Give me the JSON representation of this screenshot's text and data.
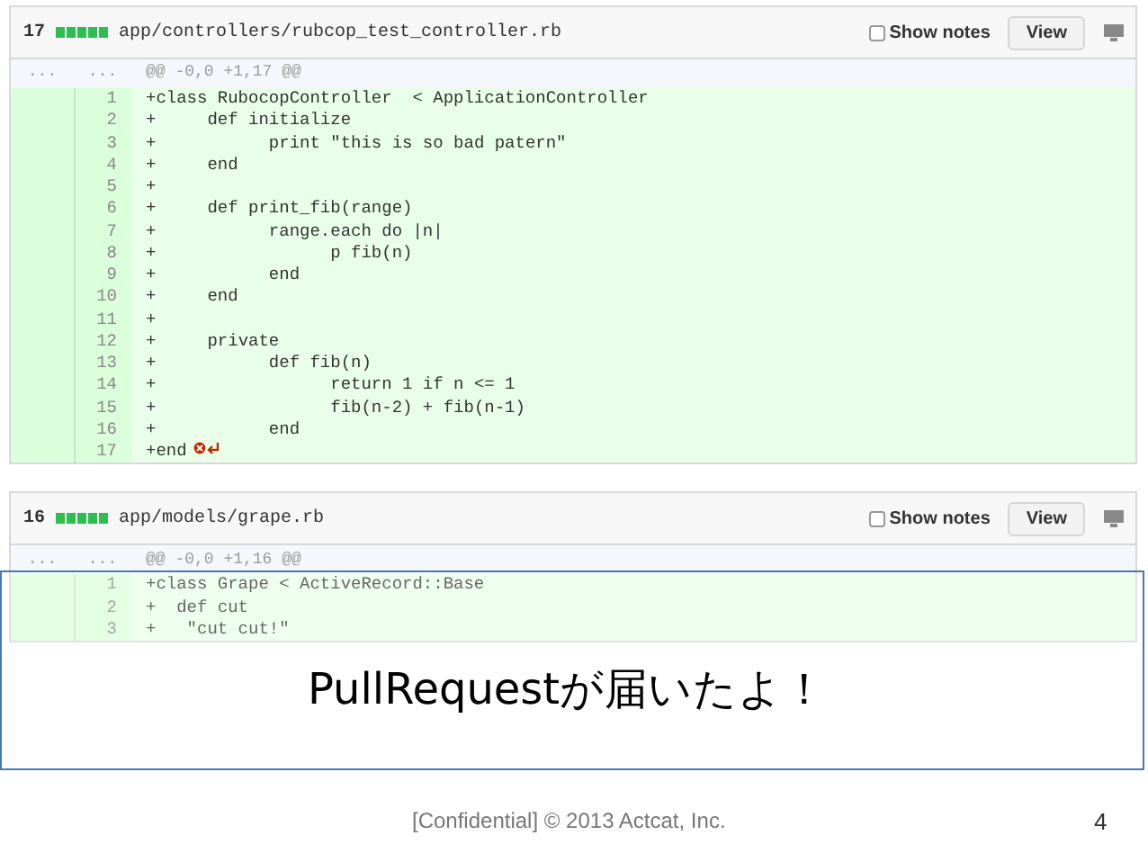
{
  "files": [
    {
      "additions": "17",
      "path": "app/controllers/rubcop_test_controller.rb",
      "show_notes": {
        "label": "Show notes",
        "checked": false
      },
      "view_button": "View",
      "hunk": {
        "old_marker": "...",
        "new_marker": "...",
        "header": "@@ -0,0 +1,17 @@"
      },
      "lines": [
        {
          "number": "1",
          "text": "+class RubocopController  < ApplicationController",
          "no_newline": false
        },
        {
          "number": "2",
          "text": "+\tdef initialize",
          "no_newline": false
        },
        {
          "number": "3",
          "text": "+\t\tprint \"this is so bad patern\"",
          "no_newline": false
        },
        {
          "number": "4",
          "text": "+\tend",
          "no_newline": false
        },
        {
          "number": "5",
          "text": "+",
          "no_newline": false
        },
        {
          "number": "6",
          "text": "+\tdef print_fib(range)",
          "no_newline": false
        },
        {
          "number": "7",
          "text": "+\t\trange.each do |n|",
          "no_newline": false
        },
        {
          "number": "8",
          "text": "+\t\t\tp fib(n)",
          "no_newline": false
        },
        {
          "number": "9",
          "text": "+\t\tend",
          "no_newline": false
        },
        {
          "number": "10",
          "text": "+\tend",
          "no_newline": false
        },
        {
          "number": "11",
          "text": "+",
          "no_newline": false
        },
        {
          "number": "12",
          "text": "+\tprivate",
          "no_newline": false
        },
        {
          "number": "13",
          "text": "+\t\tdef fib(n)",
          "no_newline": false
        },
        {
          "number": "14",
          "text": "+\t\t\treturn 1 if n <= 1",
          "no_newline": false
        },
        {
          "number": "15",
          "text": "+\t\t\tfib(n-2) + fib(n-1)",
          "no_newline": false
        },
        {
          "number": "16",
          "text": "+\t\tend",
          "no_newline": false
        },
        {
          "number": "17",
          "text": "+end",
          "no_newline": true
        }
      ]
    },
    {
      "additions": "16",
      "path": "app/models/grape.rb",
      "show_notes": {
        "label": "Show notes",
        "checked": false
      },
      "view_button": "View",
      "hunk": {
        "old_marker": "...",
        "new_marker": "...",
        "header": "@@ -0,0 +1,16 @@"
      },
      "lines": [
        {
          "number": "1",
          "text": "+class Grape < ActiveRecord::Base",
          "no_newline": false
        },
        {
          "number": "2",
          "text": "+  def cut",
          "no_newline": false
        },
        {
          "number": "3",
          "text": "+   \"cut cut!\"",
          "no_newline": false
        }
      ]
    }
  ],
  "caption": "PullRequestが届いたよ！",
  "footer": "[Confidential] © 2013 Actcat, Inc.",
  "page_number": "4"
}
